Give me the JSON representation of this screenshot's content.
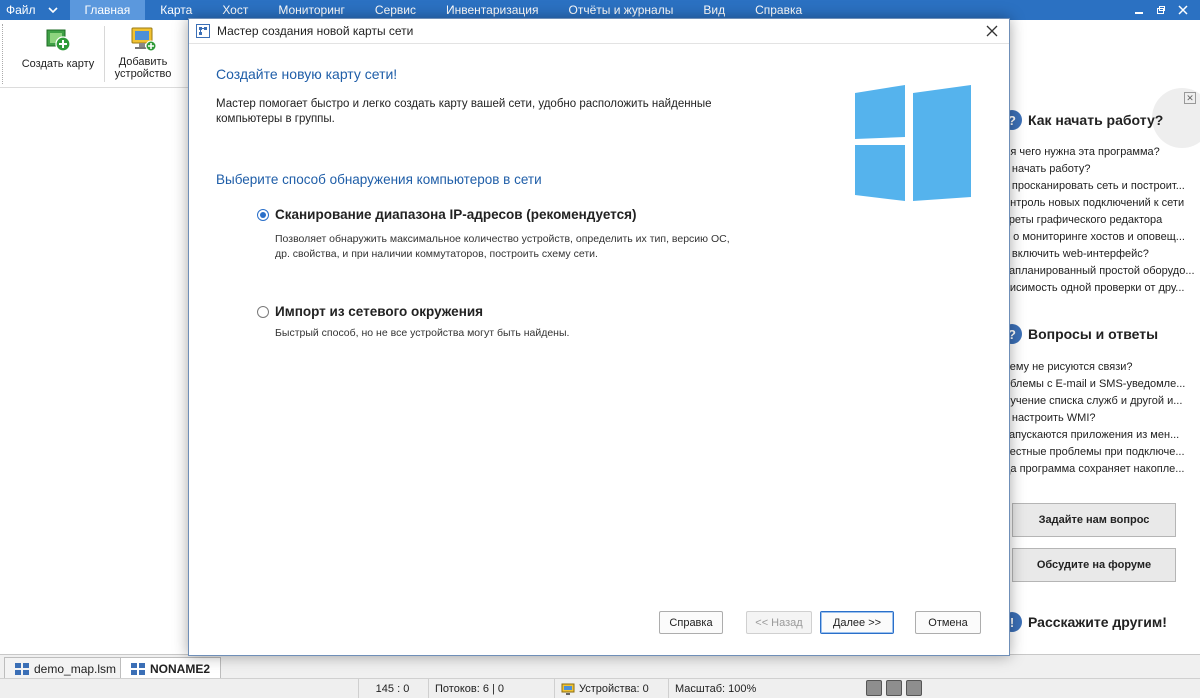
{
  "menubar": {
    "file": "Файл",
    "items": [
      "Главная",
      "Карта",
      "Хост",
      "Мониторинг",
      "Сервис",
      "Инвентаризация",
      "Отчёты и журналы",
      "Вид",
      "Справка"
    ],
    "active_index": 0
  },
  "ribbon": {
    "create_map": "Создать карту",
    "add_device_line1": "Добавить",
    "add_device_line2": "устройство"
  },
  "start_panel": {
    "howto_title": "Как начать работу?",
    "howto_items": [
      "ля чего нужна эта программа?",
      "к начать работу?",
      "к просканировать сеть и построит...",
      "онтроль новых подключений к сети",
      "креты графического редактора",
      "ё о мониторинге хостов и оповещ...",
      "к включить web-интерфейс?",
      "запланированный простой оборудо...",
      "висимость одной проверки от дру..."
    ],
    "faq_title": "Вопросы и ответы",
    "faq_items": [
      "чему не рисуются связи?",
      "облемы с E-mail и SMS-уведомле...",
      "лучение списка служб и другой и...",
      "к настроить WMI?",
      "запускаются приложения из мен...",
      "вестные проблемы при подключе...",
      "да программа сохраняет накопле..."
    ],
    "ask_button": "Задайте нам вопрос",
    "forum_button": "Обсудите на форуме",
    "share_title": "Расскажите другим!"
  },
  "doc_tabs": [
    {
      "label": "demo_map.lsm",
      "active": false
    },
    {
      "label": "NONAME2",
      "active": true
    }
  ],
  "statusbar": {
    "coords": "145 : 0",
    "threads": "Потоков: 6 | 0",
    "devices": "Устройства: 0",
    "scale": "Масштаб: 100%"
  },
  "dialog": {
    "title": "Мастер создания новой карты сети",
    "heading": "Создайте новую карту сети!",
    "description": "Мастер помогает быстро и легко создать карту вашей сети, удобно расположить найденные компьютеры в группы.",
    "subheading": "Выберите способ обнаружения компьютеров в сети",
    "options": [
      {
        "label": "Сканирование диапазона IP-адресов (рекомендуется)",
        "description": "Позволяет обнаружить максимальное количество устройств, определить их тип, версию ОС, др. свойства, и при наличии коммутаторов, построить схему сети.",
        "selected": true
      },
      {
        "label": "Импорт из сетевого окружения",
        "description": "Быстрый способ, но не все устройства могут быть найдены.",
        "selected": false
      }
    ],
    "buttons": {
      "help": "Справка",
      "back": "<< Назад",
      "next": "Далее >>",
      "cancel": "Отмена"
    }
  },
  "colors": {
    "menubar_bg": "#2b71c2",
    "menu_active_bg": "#5b98dd",
    "heading_blue": "#1f5ea8",
    "logo_blue": "#55b3ed",
    "radio_blue": "#2a6fc9"
  }
}
